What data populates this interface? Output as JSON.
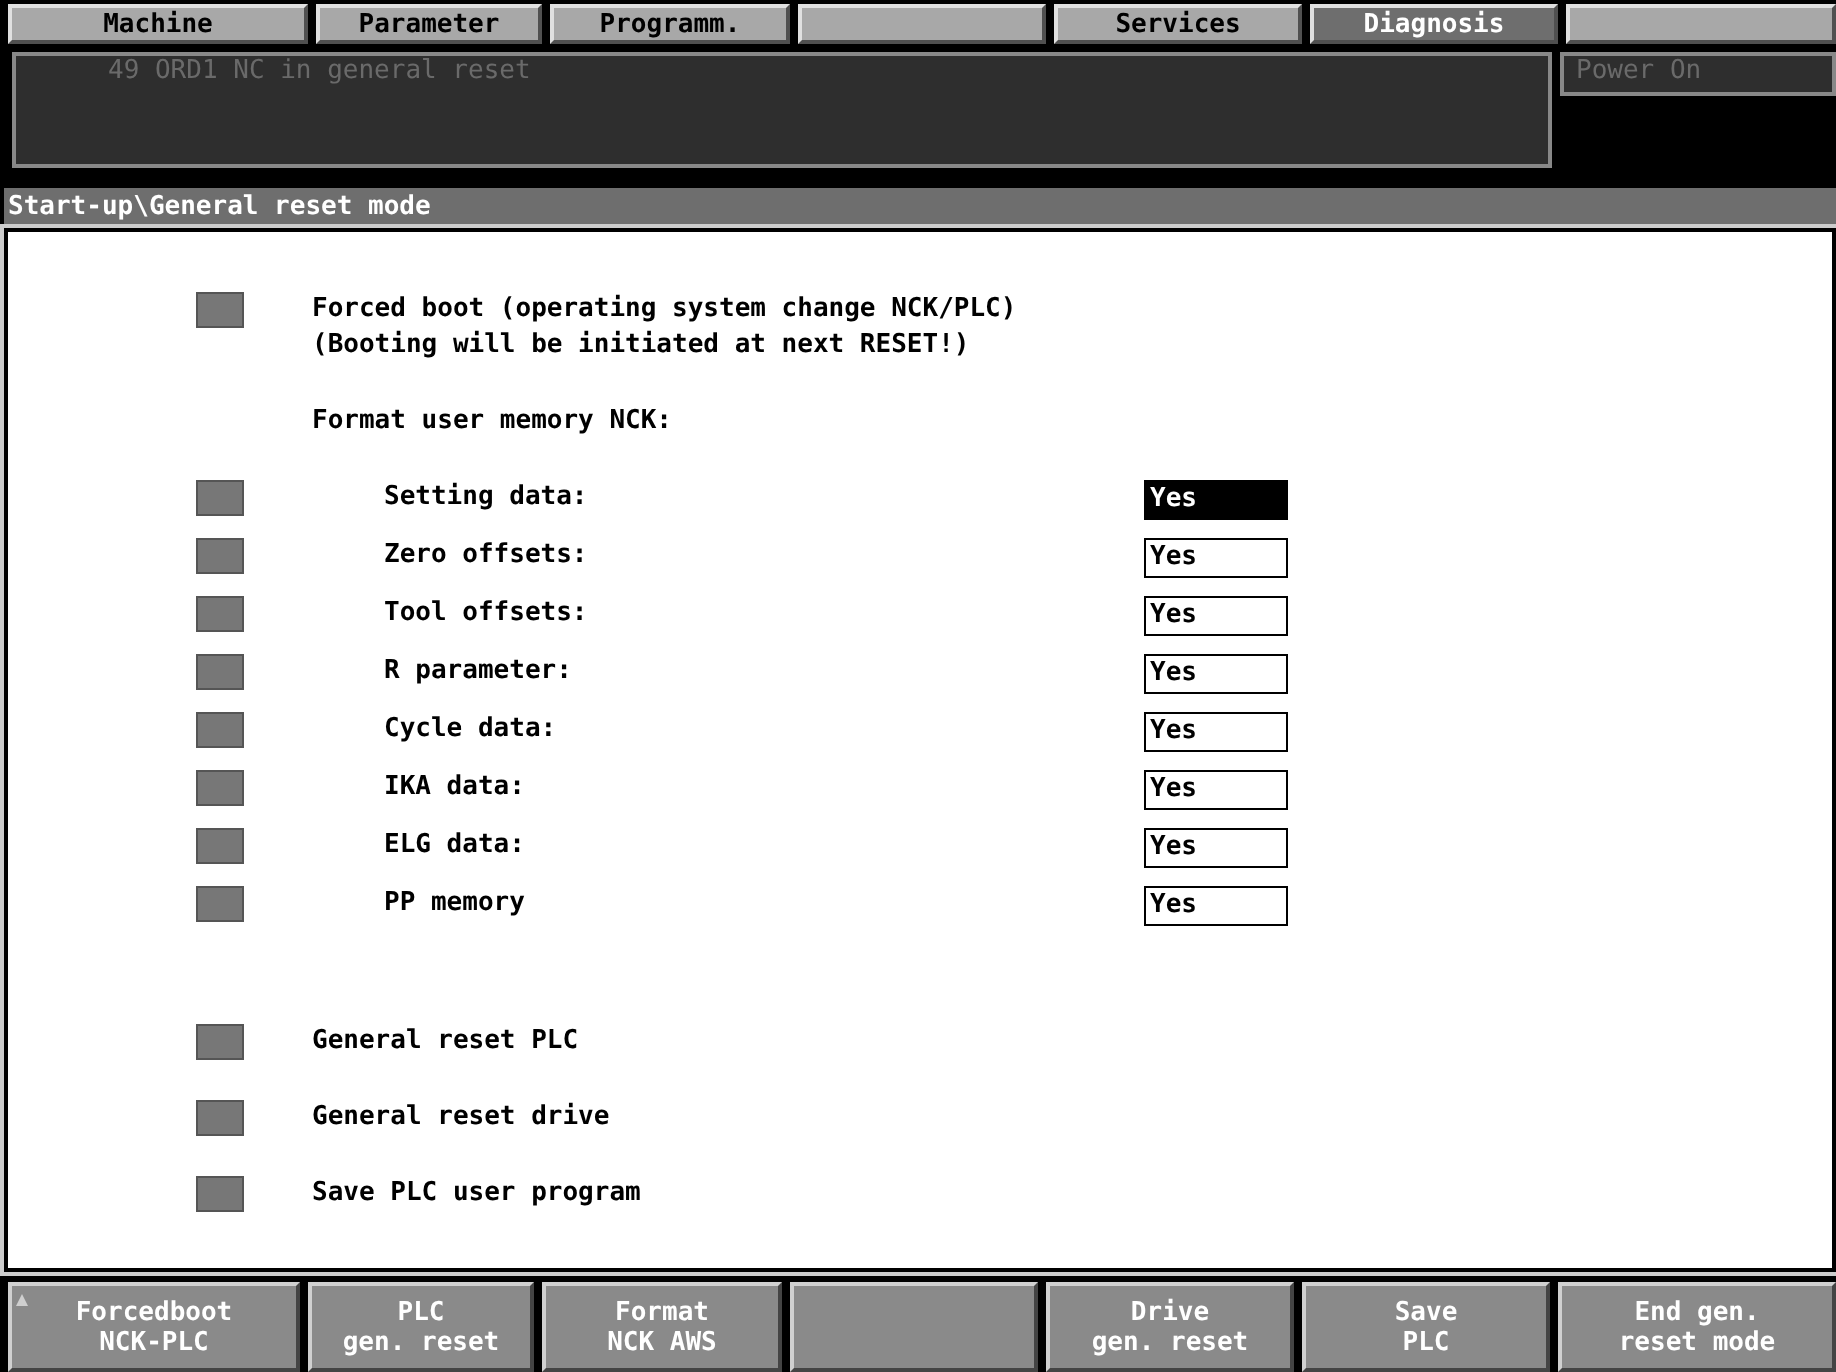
{
  "tabs": [
    {
      "label": "Machine",
      "selected": false
    },
    {
      "label": "Parameter",
      "selected": false
    },
    {
      "label": "Programm.",
      "selected": false
    },
    {
      "selected": false
    },
    {
      "label": "Services",
      "selected": false
    },
    {
      "label": "Diagnosis",
      "selected": true
    },
    {
      "selected": false
    }
  ],
  "alarm": {
    "text": "49 ORD1 NC in general reset"
  },
  "status": "Power On",
  "header": "Start-up\\General reset mode",
  "items": [
    {
      "kind": "option",
      "lines": [
        "Forced boot (operating system change NCK/PLC)",
        "(Booting will be initiated at next RESET!)"
      ]
    },
    {
      "kind": "heading",
      "label": "Format user memory NCK:"
    },
    {
      "kind": "field",
      "label": "Setting data:",
      "value": "Yes",
      "selected": true
    },
    {
      "kind": "field",
      "label": "Zero offsets:",
      "value": "Yes",
      "selected": false
    },
    {
      "kind": "field",
      "label": "Tool offsets:",
      "value": "Yes",
      "selected": false
    },
    {
      "kind": "field",
      "label": "R parameter:",
      "value": "Yes",
      "selected": false
    },
    {
      "kind": "field",
      "label": "Cycle data:",
      "value": "Yes",
      "selected": false
    },
    {
      "kind": "field",
      "label": "IKA data:",
      "value": "Yes",
      "selected": false
    },
    {
      "kind": "field",
      "label": "ELG data:",
      "value": "Yes",
      "selected": false
    },
    {
      "kind": "field",
      "label": "PP memory",
      "value": "Yes",
      "selected": false
    },
    {
      "kind": "spacer"
    },
    {
      "kind": "option",
      "lines": [
        "General reset PLC"
      ]
    },
    {
      "kind": "option",
      "lines": [
        "General reset drive"
      ]
    },
    {
      "kind": "option",
      "lines": [
        "Save PLC user program"
      ]
    }
  ],
  "softkeys": [
    {
      "kind": "key",
      "lines": [
        "Forcedboot",
        "NCK-PLC"
      ],
      "more": true
    },
    {
      "kind": "key",
      "lines": [
        "PLC",
        "gen. reset"
      ],
      "more": false
    },
    {
      "kind": "key",
      "lines": [
        "Format",
        "NCK AWS"
      ],
      "more": false
    },
    {
      "kind": "blank"
    },
    {
      "kind": "key",
      "lines": [
        "Drive",
        "gen. reset"
      ],
      "more": false
    },
    {
      "kind": "key",
      "lines": [
        "Save",
        "PLC"
      ],
      "more": false
    },
    {
      "kind": "key",
      "lines": [
        "End gen.",
        "reset mode"
      ],
      "more": false
    }
  ]
}
